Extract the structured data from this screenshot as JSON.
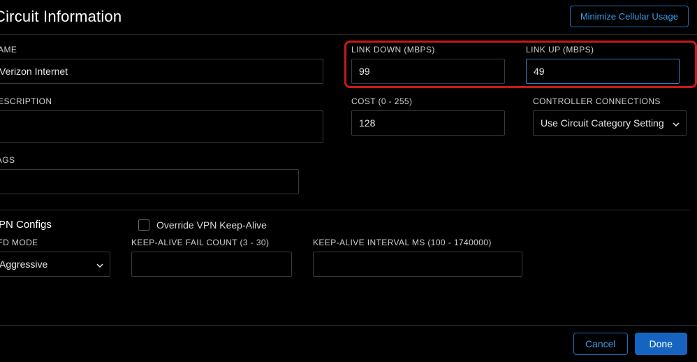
{
  "header": {
    "title": "Circuit Information",
    "minimize_btn": "Minimize Cellular Usage"
  },
  "fields": {
    "name": {
      "label": "NAME",
      "value": "Verizon Internet"
    },
    "link_down": {
      "label": "LINK DOWN (Mbps)",
      "value": "99"
    },
    "link_up": {
      "label": "LINK UP (Mbps)",
      "value": "49"
    },
    "description": {
      "label": "DESCRIPTION",
      "value": ""
    },
    "cost": {
      "label": "COST (0 - 255)",
      "value": "128"
    },
    "controller": {
      "label": "CONTROLLER CONNECTIONS",
      "value": "Use Circuit Category Setting"
    },
    "tags": {
      "label": "TAGS",
      "value": ""
    }
  },
  "vpn": {
    "section_title": "VPN Configs",
    "override_label": "Override VPN Keep-Alive",
    "override_checked": false,
    "bfd_mode": {
      "label": "BFD MODE",
      "value": "Aggressive"
    },
    "fail_count": {
      "label": "KEEP-ALIVE FAIL COUNT (3 - 30)",
      "value": ""
    },
    "interval": {
      "label": "KEEP-ALIVE INTERVAL MS (100 - 1740000)",
      "value": ""
    }
  },
  "footer": {
    "cancel": "Cancel",
    "done": "Done"
  }
}
